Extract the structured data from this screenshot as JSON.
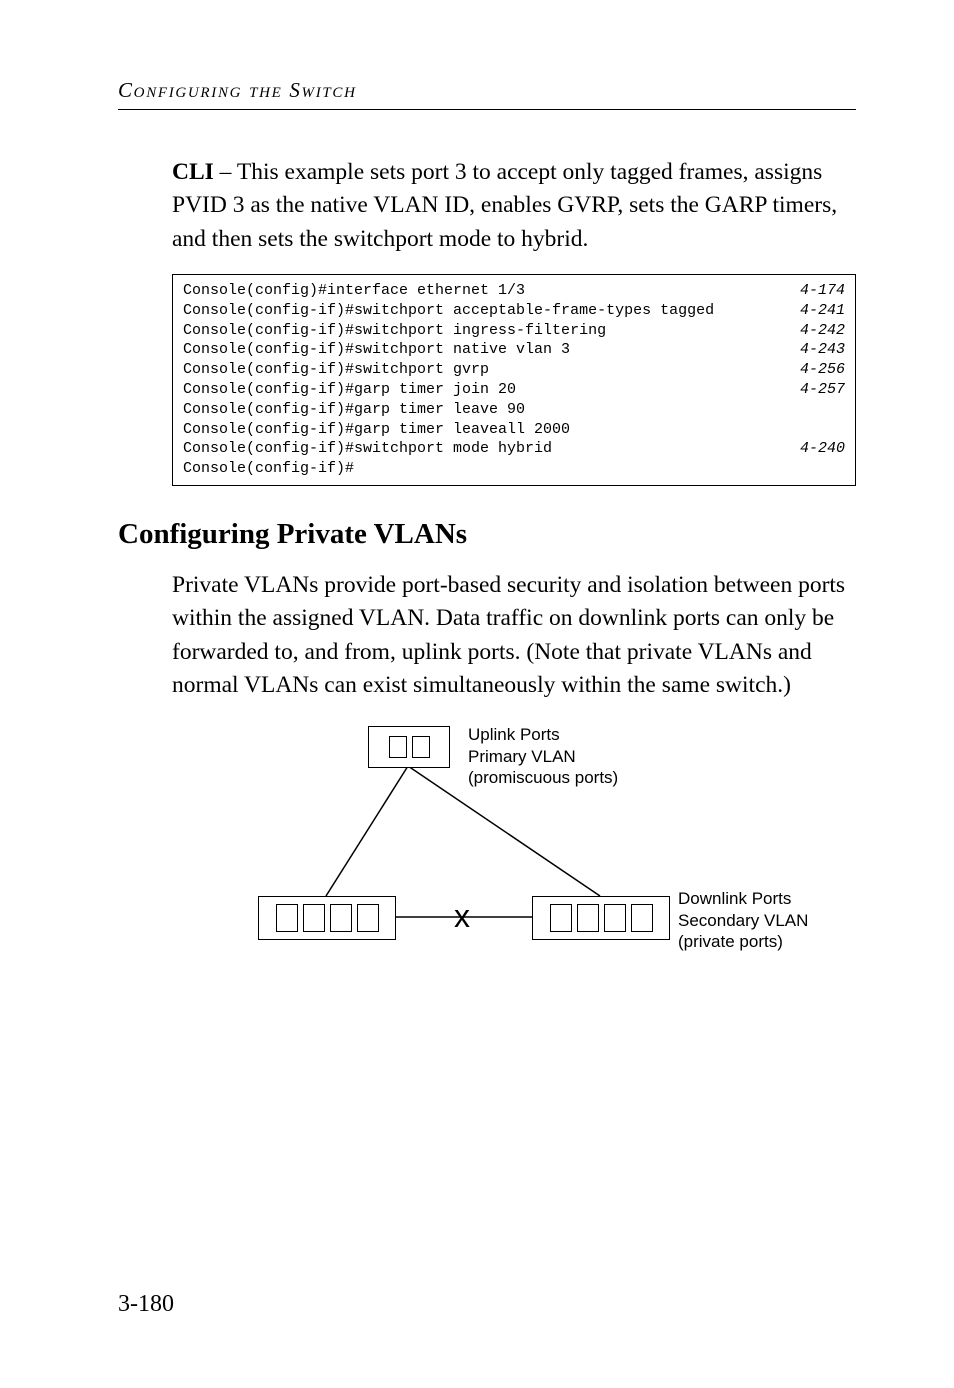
{
  "running_head": "Configuring the Switch",
  "intro_para_html": "<b>CLI</b> – This example sets port 3 to accept only tagged frames, assigns PVID 3 as the native VLAN ID, enables GVRP, sets the GARP timers, and then sets the switchport mode to hybrid.",
  "code": {
    "lines": [
      {
        "left": "Console(config)#interface ethernet 1/3",
        "right": "4-174"
      },
      {
        "left": "Console(config-if)#switchport acceptable-frame-types tagged",
        "right": "4-241"
      },
      {
        "left": "Console(config-if)#switchport ingress-filtering",
        "right": "4-242"
      },
      {
        "left": "Console(config-if)#switchport native vlan 3",
        "right": "4-243"
      },
      {
        "left": "Console(config-if)#switchport gvrp",
        "right": "4-256"
      },
      {
        "left": "Console(config-if)#garp timer join 20",
        "right": "4-257"
      },
      {
        "left": "Console(config-if)#garp timer leave 90",
        "right": ""
      },
      {
        "left": "Console(config-if)#garp timer leaveall 2000",
        "right": ""
      },
      {
        "left": "Console(config-if)#switchport mode hybrid",
        "right": "4-240"
      },
      {
        "left": "Console(config-if)#",
        "right": ""
      }
    ]
  },
  "section_title": "Configuring Private VLANs",
  "section_para": "Private VLANs provide port-based security and isolation between ports within the assigned VLAN. Data traffic on downlink ports can only be forwarded to, and from, uplink ports. (Note that private VLANs and normal VLANs can exist simultaneously within the same switch.)",
  "diagram": {
    "uplink_label_l1": "Uplink Ports",
    "uplink_label_l2": "Primary VLAN",
    "uplink_label_l3": "(promiscuous ports)",
    "downlink_label_l1": "Downlink Ports",
    "downlink_label_l2": "Secondary VLAN",
    "downlink_label_l3": "(private ports)",
    "x": "x"
  },
  "page_number": "3-180"
}
